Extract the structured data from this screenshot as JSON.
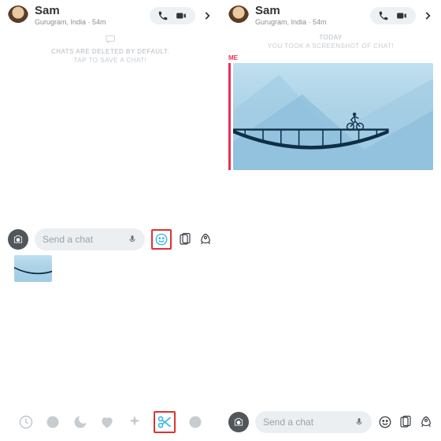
{
  "left": {
    "header": {
      "name": "Sam",
      "sub": "Gurugram, India · 54m"
    },
    "system": {
      "line1": "CHATS ARE DELETED BY DEFAULT.",
      "line2": "TAP TO SAVE A CHAT!"
    },
    "input": {
      "placeholder": "Send a chat"
    }
  },
  "right": {
    "header": {
      "name": "Sam",
      "sub": "Gurugram, India · 54m"
    },
    "system": {
      "day": "TODAY",
      "event": "YOU TOOK A SCREENSHOT OF CHAT!"
    },
    "me_label": "ME",
    "input": {
      "placeholder": "Send a chat"
    }
  },
  "icons": {
    "phone": "phone-icon",
    "video": "video-icon",
    "chevron": "chevron-right-icon",
    "chat": "chat-bubble-icon",
    "camera": "camera-icon",
    "mic": "microphone-icon",
    "smile": "smiley-icon",
    "sticker": "sticker-icon",
    "rocket": "rocket-icon",
    "clock": "clock-icon",
    "emoji": "emoji-icon",
    "moon": "moon-icon",
    "heart": "heart-icon",
    "sparkle": "sparkle-icon",
    "scissors": "scissors-icon",
    "face": "face-icon"
  }
}
